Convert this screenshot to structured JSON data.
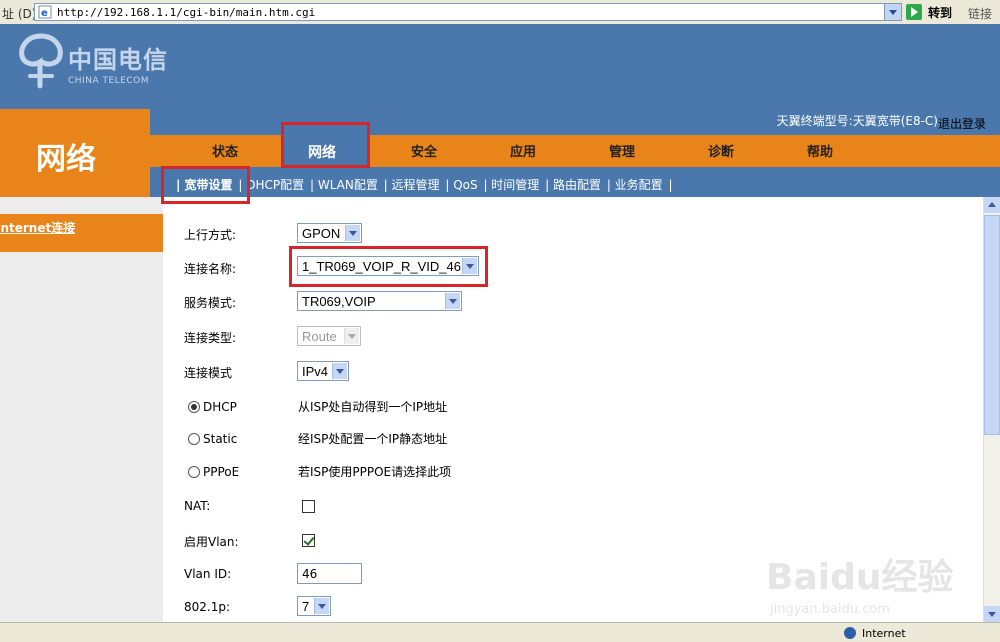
{
  "browser": {
    "address_label": "址 (D)",
    "url": "http://192.168.1.1/cgi-bin/main.htm.cgi",
    "go_label": "转到",
    "links_label": "链接"
  },
  "header": {
    "logo_text": "中国电信",
    "logo_sub": "CHINA TELECOM",
    "model_text": "天翼终端型号:天翼宽带(E8-C)",
    "logout": "退出登录"
  },
  "left_title": "网络",
  "nav": {
    "tabs": [
      {
        "label": "状态"
      },
      {
        "label": "网络",
        "active": true
      },
      {
        "label": "安全"
      },
      {
        "label": "应用"
      },
      {
        "label": "管理"
      },
      {
        "label": "诊断"
      },
      {
        "label": "帮助"
      }
    ]
  },
  "subnav": {
    "items": [
      "| 宽带设置",
      "| DHCP配置",
      "| WLAN配置",
      "| 远程管理",
      "| QoS",
      "| 时间管理",
      "| 路由配置",
      "| 业务配置",
      "|"
    ]
  },
  "sidebar": {
    "item": "Internet连接"
  },
  "form": {
    "uplink_label": "上行方式:",
    "uplink_value": "GPON",
    "conn_name_label": "连接名称:",
    "conn_name_value": "1_TR069_VOIP_R_VID_46",
    "service_mode_label": "服务模式:",
    "service_mode_value": "TR069,VOIP",
    "conn_type_label": "连接类型:",
    "conn_type_value": "Route",
    "conn_mode_label": "连接模式",
    "conn_mode_value": "IPv4",
    "radios": [
      {
        "label": "DHCP",
        "desc": "从ISP处自动得到一个IP地址",
        "checked": true
      },
      {
        "label": "Static",
        "desc": "经ISP处配置一个IP静态地址",
        "checked": false
      },
      {
        "label": "PPPoE",
        "desc": "若ISP使用PPPOE请选择此项",
        "checked": false
      }
    ],
    "nat_label": "NAT:",
    "nat_checked": false,
    "vlan_enable_label": "启用Vlan:",
    "vlan_enable_checked": true,
    "vlan_id_label": "Vlan ID:",
    "vlan_id_value": "46",
    "dot1p_label": "802.1p:",
    "dot1p_value": "7"
  },
  "statusbar": {
    "zone": "Internet"
  },
  "watermark": {
    "logo": "Baidu经验",
    "sub": "jingyan.baidu.com"
  },
  "colors": {
    "header_blue": "#4a78ad",
    "nav_orange": "#e8841a",
    "highlight_red": "#d9252a"
  }
}
